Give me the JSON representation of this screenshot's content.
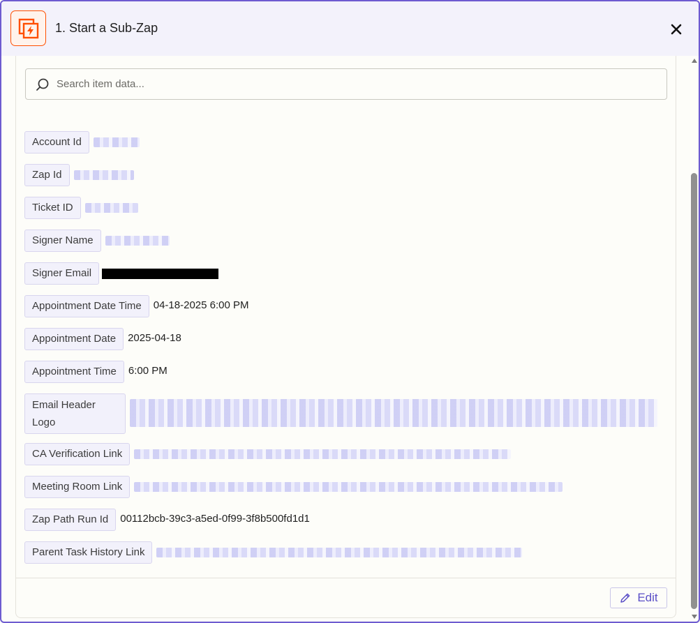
{
  "header": {
    "title": "1. Start a Sub-Zap",
    "app_icon": "sub-zap-icon",
    "close_icon": "close-icon"
  },
  "search": {
    "placeholder": "Search item data...",
    "value": ""
  },
  "fields": [
    {
      "label": "Account Id",
      "value": "",
      "redacted": "blurred"
    },
    {
      "label": "Zap Id",
      "value": "",
      "redacted": "blurred"
    },
    {
      "label": "Ticket ID",
      "value": "",
      "redacted": "blurred"
    },
    {
      "label": "Signer Name",
      "value": "",
      "redacted": "blurred"
    },
    {
      "label": "Signer Email",
      "value": "",
      "redacted": "black-bar"
    },
    {
      "label": "Appointment Date Time",
      "value": "04-18-2025 6:00 PM"
    },
    {
      "label": "Appointment Date",
      "value": "2025-04-18"
    },
    {
      "label": "Appointment Time",
      "value": "6:00 PM"
    },
    {
      "label": "Email Header Logo",
      "value": "",
      "redacted": "blurred"
    },
    {
      "label": "CA Verification Link",
      "value": "",
      "redacted": "blurred"
    },
    {
      "label": "Meeting Room Link",
      "value": "",
      "redacted": "blurred"
    },
    {
      "label": "Zap Path Run Id",
      "value": "00112bcb-39c3-a5ed-0f99-3f8b500fd1d1"
    },
    {
      "label": "Parent Task History Link",
      "value": "",
      "redacted": "blurred"
    }
  ],
  "footer": {
    "edit_label": "Edit"
  },
  "colors": {
    "accent": "#5b4fc7",
    "brand_orange": "#ff4f00",
    "tag_bg": "#f2f1fb",
    "frame_border": "#6d5bd0"
  }
}
